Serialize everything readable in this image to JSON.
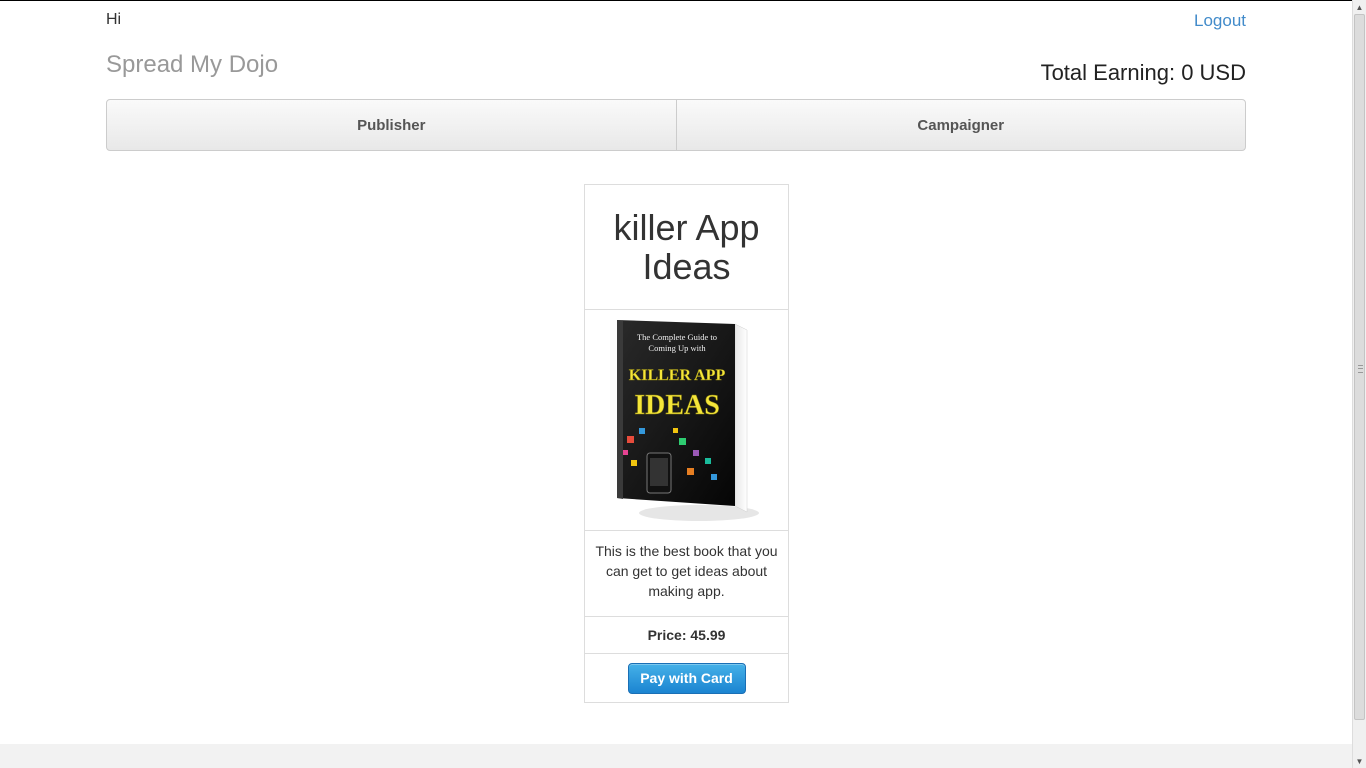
{
  "header": {
    "greeting": "Hi",
    "logout_label": "Logout",
    "brand": "Spread My Dojo",
    "total_earning": "Total Earning: 0 USD"
  },
  "nav": {
    "items": [
      {
        "label": "Publisher"
      },
      {
        "label": "Campaigner"
      }
    ]
  },
  "product": {
    "title": "killer App Ideas",
    "cover": {
      "line1": "The Complete Guide to",
      "line2": "Coming Up with",
      "line3": "KILLER APP",
      "line4": "IDEAS"
    },
    "description": "This is the best book that you can get to get ideas about making app.",
    "price": "Price: 45.99",
    "pay_label": "Pay with Card"
  },
  "colors": {
    "link": "#428bca",
    "pay_button": "#1b84d1",
    "cover_text": "#f5e63a"
  }
}
